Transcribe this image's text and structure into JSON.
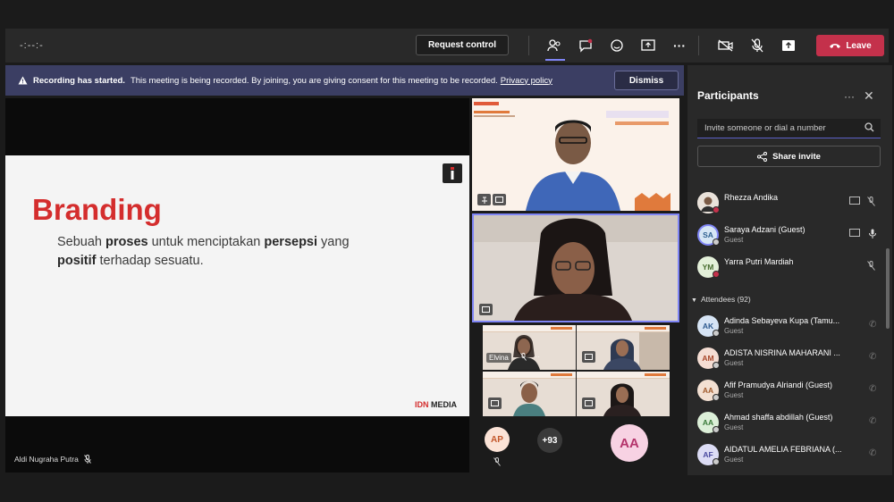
{
  "topbar": {
    "timer": "-:--:-",
    "request_control": "Request control",
    "leave": "Leave",
    "accent_color": "#c4314b",
    "icons": [
      "people-icon",
      "chat-icon",
      "reactions-icon",
      "share-tray-icon",
      "more-icon",
      "camera-off-icon",
      "mic-off-icon",
      "share-icon",
      "phone-hangup-icon"
    ]
  },
  "banner": {
    "bold": "Recording has started.",
    "text": "This meeting is being recorded. By joining, you are giving consent for this meeting to be recorded.",
    "link": "Privacy policy",
    "dismiss": "Dismiss"
  },
  "slide": {
    "title": "Branding",
    "body_1": "Sebuah ",
    "body_b1": "proses",
    "body_2": " untuk menciptakan ",
    "body_b2": "persepsi",
    "body_3": " yang",
    "body_b3": "positif",
    "body_4": " terhadap sesuatu.",
    "logo_idn": "IDN",
    "logo_media": "MEDIA"
  },
  "presenter": {
    "name": "Aldi Nugraha Putra"
  },
  "videos": {
    "small_name": "Elvina",
    "avatar_ap": "AP",
    "more_count": "+93",
    "avatar_big": "AA"
  },
  "panel": {
    "title": "Participants",
    "invite_placeholder": "Invite someone or dial a number",
    "share_invite": "Share invite",
    "attendees_label": "Attendees (92)",
    "presenters": [
      {
        "initials": "",
        "name": "Rhezza Andika",
        "sub": ""
      },
      {
        "initials": "SA",
        "name": "Saraya Adzani (Guest)",
        "sub": "Guest"
      },
      {
        "initials": "YM",
        "name": "Yarra Putri Mardiah",
        "sub": ""
      }
    ],
    "attendees": [
      {
        "initials": "AK",
        "name": "Adinda Sebayeva Kupa (Tamu...",
        "sub": "Guest"
      },
      {
        "initials": "AM",
        "name": "ADISTA NISRINA MAHARANI ...",
        "sub": "Guest"
      },
      {
        "initials": "AA",
        "name": "Afif Pramudya Alriandi (Guest)",
        "sub": "Guest"
      },
      {
        "initials": "AA",
        "name": "Ahmad shaffa abdillah (Guest)",
        "sub": "Guest"
      },
      {
        "initials": "AF",
        "name": "AIDATUL AMELIA FEBRIANA (...",
        "sub": "Guest"
      }
    ]
  }
}
